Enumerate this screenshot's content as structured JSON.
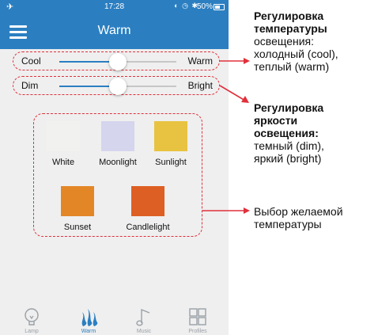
{
  "status_bar": {
    "time": "17:28",
    "battery": "50%",
    "battery_level": 0.5
  },
  "header": {
    "title": "Warm"
  },
  "sliders": {
    "temperature": {
      "left_label": "Cool",
      "right_label": "Warm",
      "value": 0.5
    },
    "brightness": {
      "left_label": "Dim",
      "right_label": "Bright",
      "value": 0.5
    }
  },
  "presets": [
    {
      "label": "White",
      "color": "#f1f1ef"
    },
    {
      "label": "Moonlight",
      "color": "#d5d5ee"
    },
    {
      "label": "Sunlight",
      "color": "#e8c341"
    },
    {
      "label": "Sunset",
      "color": "#e38726"
    },
    {
      "label": "Candlelight",
      "color": "#dd5f23"
    }
  ],
  "tabs": [
    {
      "label": "Lamp",
      "icon": "bulb-icon",
      "active": false
    },
    {
      "label": "Warm",
      "icon": "flame-icon",
      "active": true
    },
    {
      "label": "Music",
      "icon": "music-note-icon",
      "active": false
    },
    {
      "label": "Profiles",
      "icon": "grid-icon",
      "active": false
    }
  ],
  "colors": {
    "accent": "#2b7fc1",
    "annotation": "#e0303b"
  },
  "annotations": {
    "temperature": {
      "bold": [
        "Регулировка",
        "температуры"
      ],
      "normal": [
        "освещения:",
        "холодный (cool),",
        "теплый (warm)"
      ]
    },
    "brightness": {
      "bold": [
        "Регулировка",
        "яркости",
        "освещения:"
      ],
      "normal": [
        "темный (dim),",
        "яркий (bright)"
      ]
    },
    "presets": {
      "normal": [
        "Выбор желаемой",
        "температуры"
      ]
    }
  }
}
